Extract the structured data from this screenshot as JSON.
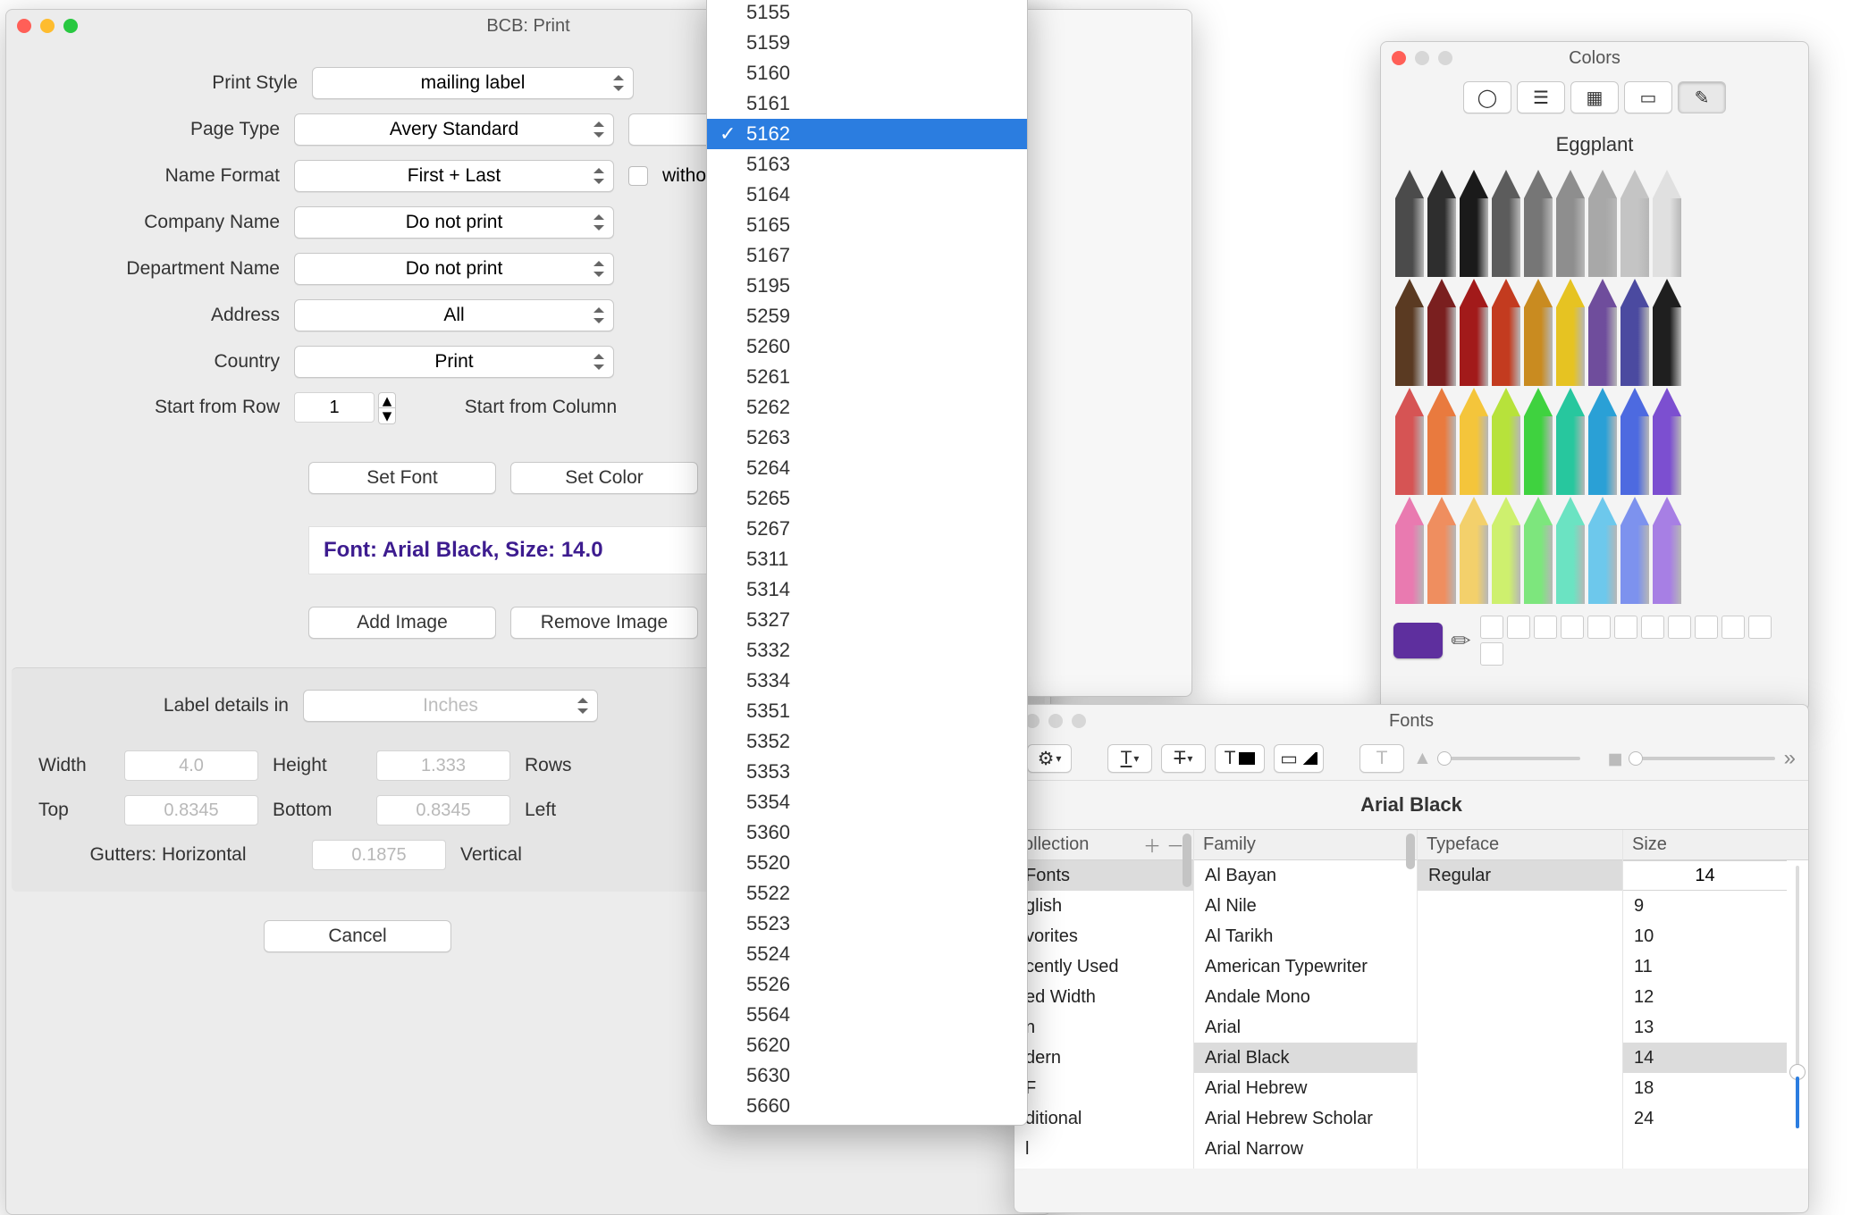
{
  "print": {
    "title": "BCB: Print",
    "style_label": "Print Style",
    "style_value": "mailing label",
    "page_type_label": "Page Type",
    "page_type_value": "Avery Standard",
    "name_format_label": "Name Format",
    "name_format_value": "First + Last",
    "without_title_label": "witho",
    "company_label": "Company Name",
    "company_value": "Do not print",
    "dept_label": "Department Name",
    "dept_value": "Do not print",
    "address_label": "Address",
    "address_value": "All",
    "country_label": "Country",
    "country_value": "Print",
    "start_row_label": "Start from Row",
    "start_row_value": "1",
    "start_col_label": "Start from Column",
    "set_font": "Set Font",
    "set_color": "Set Color",
    "font_summary": "Font: Arial Black, Size: 14.0",
    "add_image": "Add Image",
    "remove_image": "Remove Image",
    "details_label": "Label details in",
    "units_value": "Inches",
    "width_label": "Width",
    "width_value": "4.0",
    "height_label": "Height",
    "height_value": "1.333",
    "rows_label": "Rows",
    "top_label": "Top",
    "top_value": "0.8345",
    "bottom_label": "Bottom",
    "bottom_value": "0.8345",
    "left_label": "Left",
    "gutters_label": "Gutters: Horizontal",
    "gutters_value": "0.1875",
    "vertical_label": "Vertical",
    "cancel": "Cancel"
  },
  "menu": {
    "selected": "5162",
    "items": [
      "5155",
      "5159",
      "5160",
      "5161",
      "5162",
      "5163",
      "5164",
      "5165",
      "5167",
      "5195",
      "5259",
      "5260",
      "5261",
      "5262",
      "5263",
      "5264",
      "5265",
      "5267",
      "5311",
      "5314",
      "5327",
      "5332",
      "5334",
      "5351",
      "5352",
      "5353",
      "5354",
      "5360",
      "5520",
      "5522",
      "5523",
      "5524",
      "5526",
      "5564",
      "5620",
      "5630",
      "5660"
    ]
  },
  "colors": {
    "title": "Colors",
    "selected_name": "Eggplant",
    "swatch_hex": "#5e2f9e",
    "tabs": [
      "wheel",
      "sliders",
      "palettes",
      "image",
      "pencils"
    ],
    "active_tab": 4,
    "pencil_rows": [
      [
        "#4b4b4b",
        "#2e2e2e",
        "#1a1a1a",
        "#5c5c5c",
        "#767676",
        "#8e8e8e",
        "#a8a8a8",
        "#c4c4c4",
        "#e0e0e0"
      ],
      [
        "#5a3a22",
        "#7a1f1f",
        "#a21a1a",
        "#c33b1f",
        "#c98b20",
        "#e6c322",
        "#6f4d9c",
        "#4b4aa0",
        "#1f1f1f"
      ],
      [
        "#d65454",
        "#e97a3e",
        "#f4c53b",
        "#b7e23b",
        "#3fd23f",
        "#27c79e",
        "#2aa0d6",
        "#4d6ae0",
        "#7c4fd0"
      ],
      [
        "#e97ab0",
        "#ef8e5f",
        "#f3d06b",
        "#cef06e",
        "#7de67d",
        "#6be3c2",
        "#6dc8ec",
        "#7d92ee",
        "#a77fe4"
      ]
    ]
  },
  "fonts": {
    "title": "Fonts",
    "preview_family": "Arial Black",
    "columns": {
      "collection": "ollection",
      "family": "Family",
      "typeface": "Typeface",
      "size": "Size"
    },
    "collections": [
      "Fonts",
      "glish",
      "vorites",
      "cently Used",
      "ed Width",
      "n",
      "dern",
      "F",
      "ditional",
      "l"
    ],
    "selected_collection": 0,
    "families": [
      "Al Bayan",
      "Al Nile",
      "Al Tarikh",
      "American Typewriter",
      "Andale Mono",
      "Arial",
      "Arial Black",
      "Arial Hebrew",
      "Arial Hebrew Scholar",
      "Arial Narrow"
    ],
    "selected_family": 6,
    "typefaces": [
      "Regular"
    ],
    "selected_typeface": 0,
    "size_value": "14",
    "sizes": [
      "9",
      "10",
      "11",
      "12",
      "13",
      "14",
      "18",
      "24"
    ],
    "selected_size_index": 5
  }
}
